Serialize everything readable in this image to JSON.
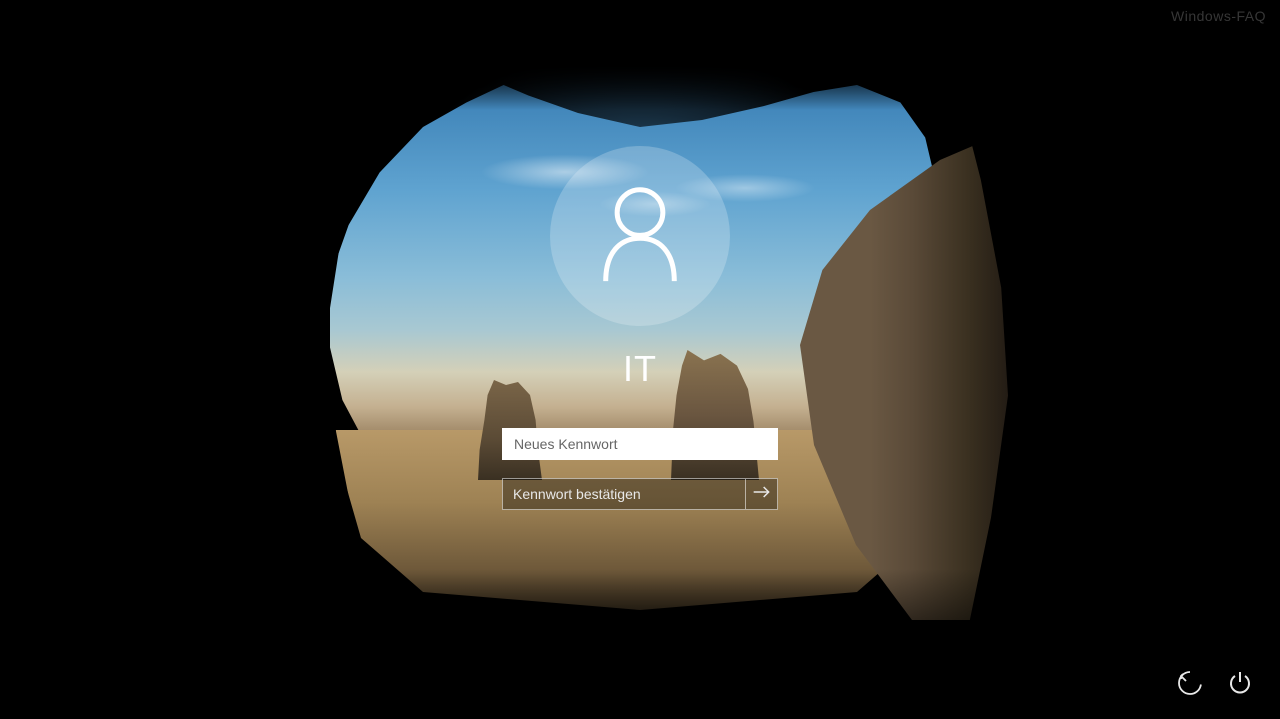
{
  "watermark": "Windows-FAQ",
  "login": {
    "username": "IT",
    "new_password_placeholder": "Neues Kennwort",
    "confirm_password_placeholder": "Kennwort bestätigen"
  },
  "icons": {
    "avatar": "person-icon",
    "submit": "arrow-right-icon",
    "ease_of_access": "ease-of-access-icon",
    "power": "power-icon"
  }
}
